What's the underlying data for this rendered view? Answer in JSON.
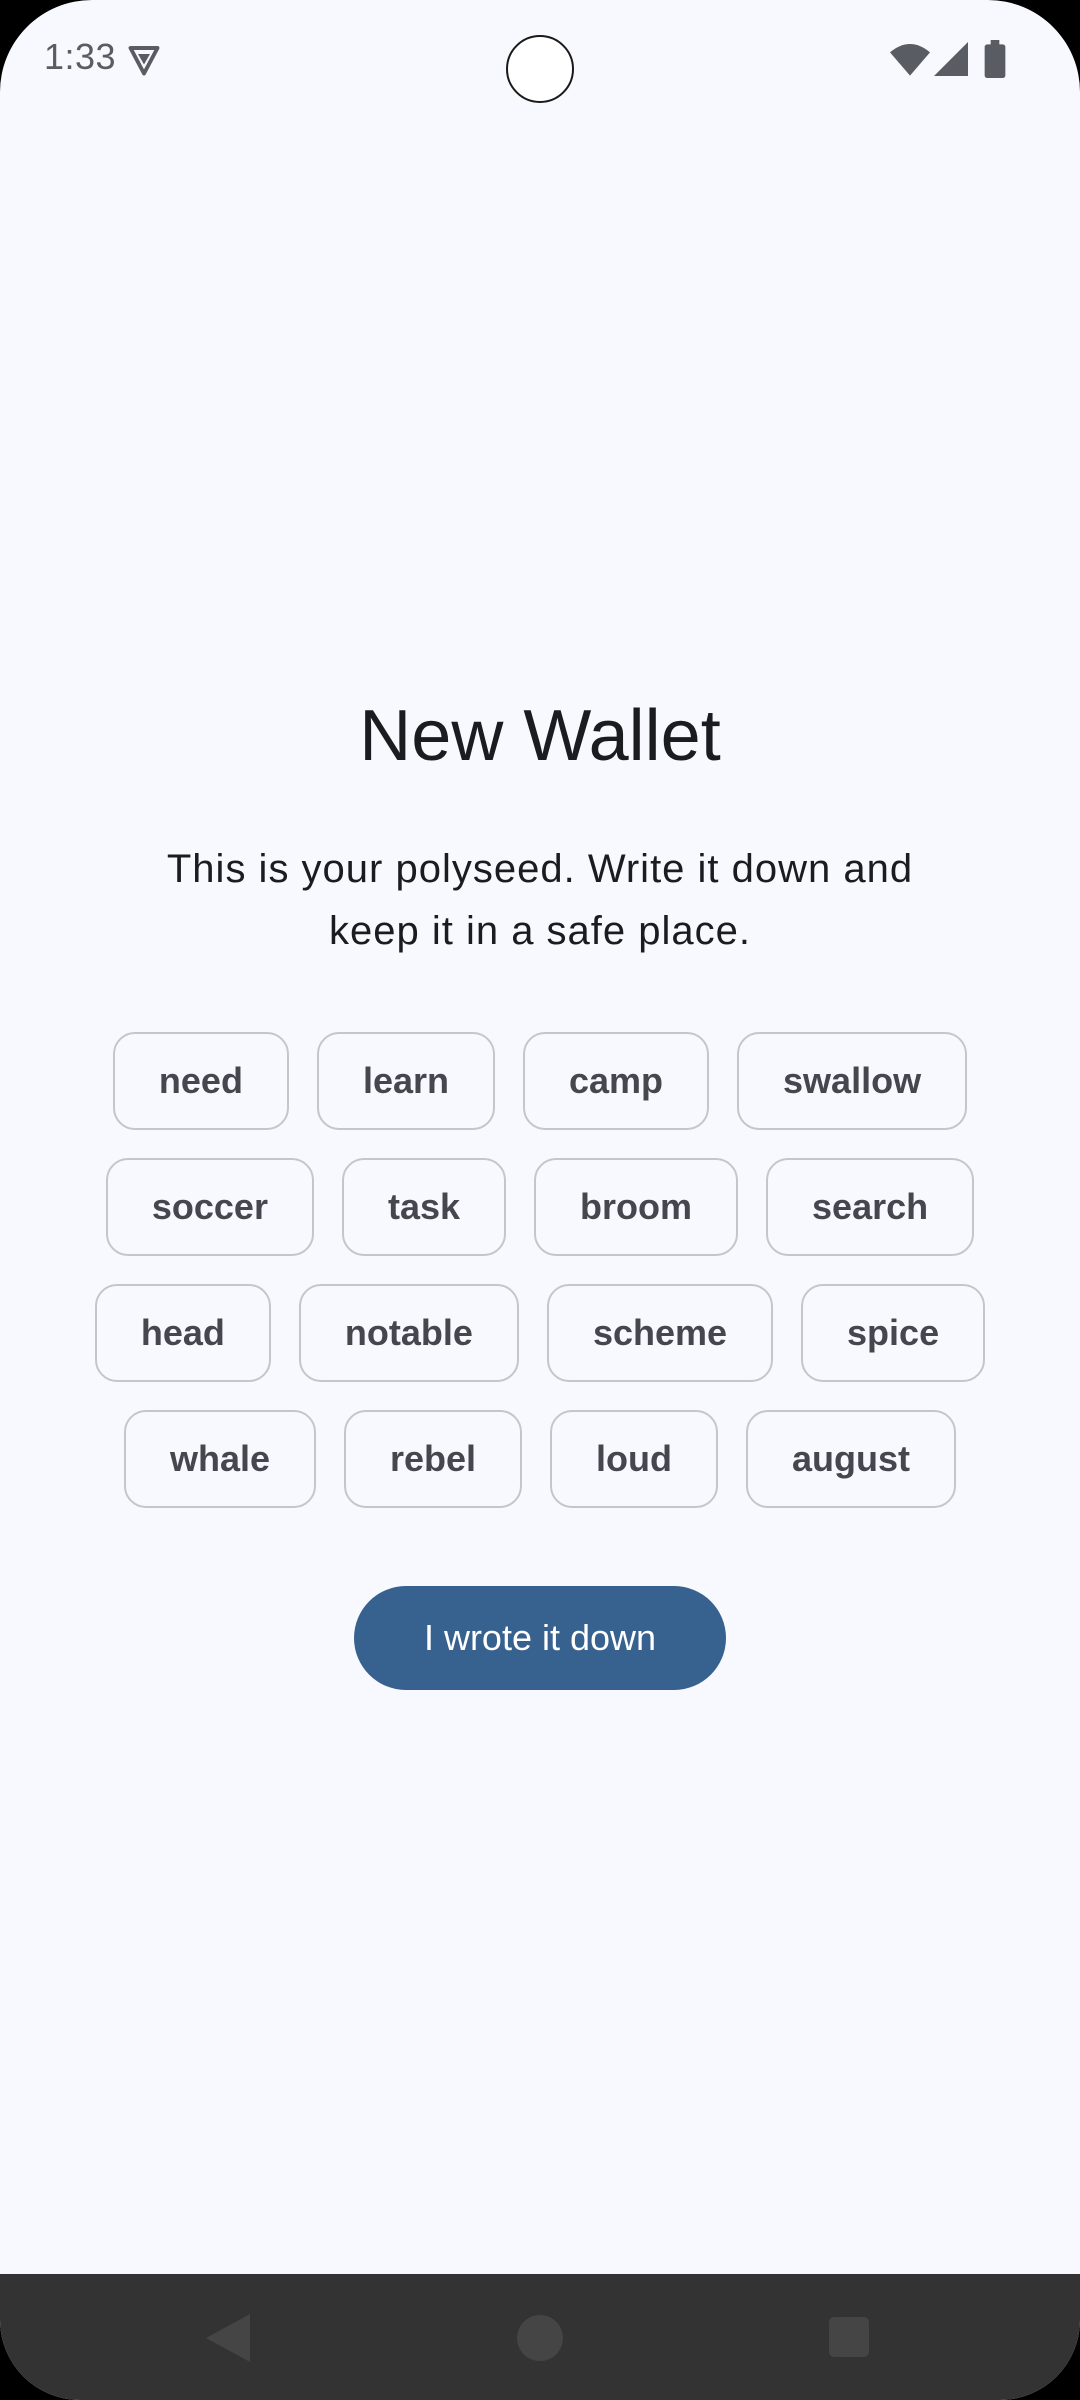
{
  "status_bar": {
    "time": "1:33"
  },
  "icons": {
    "status_left": "shield-icon",
    "wifi": "wifi-icon",
    "signal": "cellular-signal-icon",
    "battery": "battery-icon",
    "nav_back": "back-triangle-icon",
    "nav_home": "home-circle-icon",
    "nav_recents": "recents-square-icon"
  },
  "main": {
    "title": "New Wallet",
    "subtitle": "This is your polyseed. Write it down and keep it in a safe place.",
    "seed_rows": [
      [
        "need",
        "learn",
        "camp",
        "swallow"
      ],
      [
        "soccer",
        "task",
        "broom",
        "search"
      ],
      [
        "head",
        "notable",
        "scheme",
        "spice"
      ],
      [
        "whale",
        "rebel",
        "loud",
        "august"
      ]
    ],
    "confirm_label": "I wrote it down"
  },
  "colors": {
    "background": "#f8f9ff",
    "primary": "#37618e",
    "chip_border": "#c4c6cf",
    "text": "#1b1c20",
    "nav_bar": "#333333"
  }
}
